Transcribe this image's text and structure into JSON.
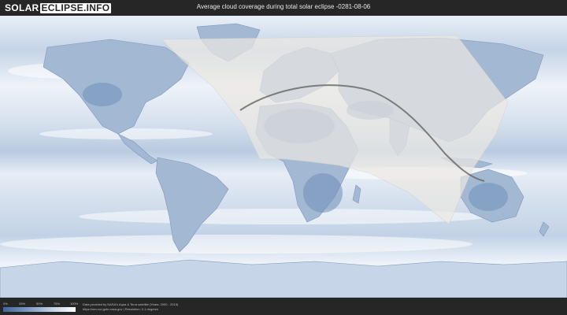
{
  "header": {
    "logo_part1": "SOLAR",
    "logo_part2": "ECLIPSE.INFO",
    "title": "Average cloud coverage during total solar eclipse -0281-08-06"
  },
  "legend": {
    "ticks": [
      "0%",
      "25%",
      "50%",
      "75%",
      "100%"
    ],
    "colors": {
      "low": "#3f6799",
      "high": "#ffffff"
    }
  },
  "footer": {
    "attribution_line1": "Data provided by NASA's Aqua & Terra satellite (Years: 2000 - 2019)",
    "attribution_line2": "https://neo.sci.gsfc.nasa.gov | Resolution: 0.1 degrees"
  },
  "map": {
    "ocean_color": "#dfe8f3",
    "land_color": "#9fb4d0",
    "penumbra_color": "#ece9e3",
    "path_color": "#6b6b6b"
  }
}
